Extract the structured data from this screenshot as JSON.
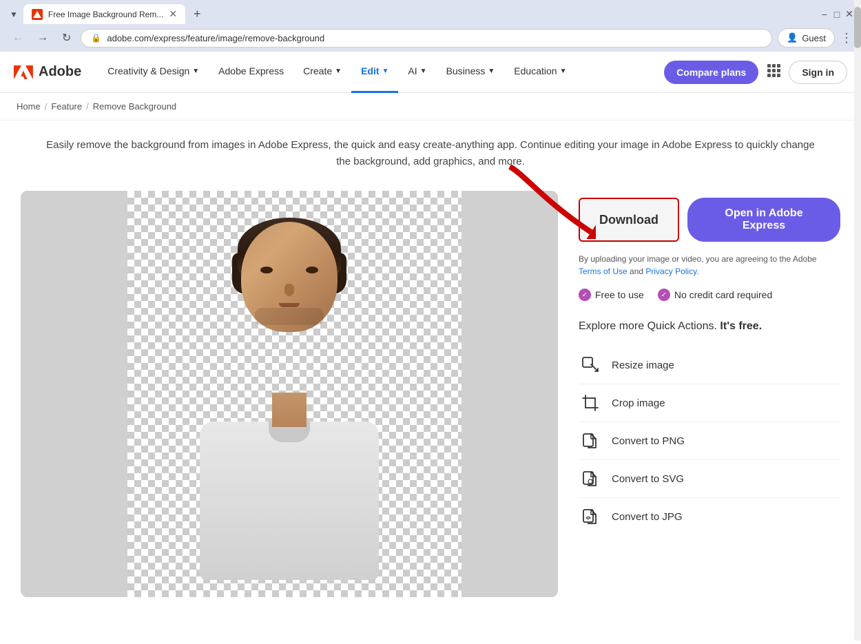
{
  "browser": {
    "tab_title": "Free Image Background Rem...",
    "url": "adobe.com/express/feature/image/remove-background",
    "tab_favicon_alt": "Adobe tab icon",
    "new_tab_label": "+",
    "guest_label": "Guest",
    "menu_dots": "⋮",
    "back_disabled": false
  },
  "nav": {
    "logo_text": "Adobe",
    "items": [
      {
        "label": "Creativity & Design",
        "has_chevron": true,
        "active": false
      },
      {
        "label": "Adobe Express",
        "has_chevron": false,
        "active": false
      },
      {
        "label": "Create",
        "has_chevron": true,
        "active": false
      },
      {
        "label": "Edit",
        "has_chevron": true,
        "active": true
      },
      {
        "label": "AI",
        "has_chevron": true,
        "active": false
      },
      {
        "label": "Business",
        "has_chevron": true,
        "active": false
      },
      {
        "label": "Education",
        "has_chevron": true,
        "active": false
      }
    ],
    "compare_plans_label": "Compare plans",
    "sign_in_label": "Sign in"
  },
  "breadcrumb": {
    "items": [
      "Home",
      "Feature",
      "Remove Background"
    ]
  },
  "hero": {
    "description": "Easily remove the background from images in Adobe Express, the quick and easy create-anything app. Continue editing your image in Adobe Express to quickly change the background, add graphics, and more."
  },
  "main": {
    "download_label": "Download",
    "open_express_label": "Open in Adobe Express",
    "terms_text": "By uploading your image or video, you are agreeing to the Adobe ",
    "terms_link1": "Terms of Use",
    "terms_and": " and ",
    "terms_link2": "Privacy Policy",
    "terms_dot": ".",
    "badge1": "Free to use",
    "badge2": "No credit card required",
    "quick_actions_title": "Explore more Quick Actions. ",
    "quick_actions_title_bold": "It's free.",
    "quick_actions": [
      {
        "label": "Resize image",
        "icon": "resize-icon"
      },
      {
        "label": "Crop image",
        "icon": "crop-icon"
      },
      {
        "label": "Convert to PNG",
        "icon": "convert-png-icon"
      },
      {
        "label": "Convert to SVG",
        "icon": "convert-svg-icon"
      },
      {
        "label": "Convert to JPG",
        "icon": "convert-jpg-icon"
      }
    ]
  },
  "page_title": "Image Background"
}
